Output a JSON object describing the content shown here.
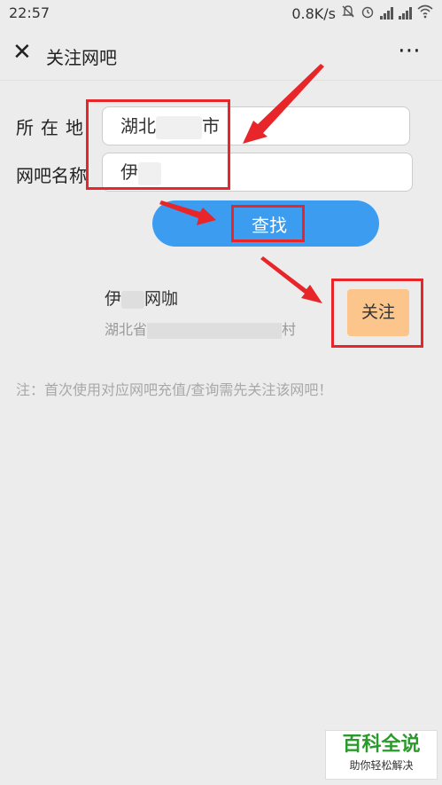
{
  "status_bar": {
    "time": "22:57",
    "network_speed": "0.8K/s",
    "icons": [
      "bell-muted-icon",
      "alarm-icon",
      "signal-icon",
      "signal-icon",
      "wifi-icon"
    ]
  },
  "nav": {
    "close_icon": "close-icon",
    "title": "关注网吧",
    "more_icon": "more-icon"
  },
  "form": {
    "location_label": "所在地",
    "location_value_start": "湖北",
    "location_value_end": "市",
    "cafe_name_label": "网吧名称",
    "cafe_name_value": "伊",
    "search_button": "查找"
  },
  "result": {
    "name_start": "伊",
    "name_end": "网咖",
    "address_start": "湖北省",
    "address_end": "村",
    "follow_button": "关注"
  },
  "note": "注：首次使用对应网吧充值/查询需先关注该网吧！",
  "watermark": {
    "title": "百科全说",
    "subtitle": "助你轻松解决"
  },
  "colors": {
    "background": "#ececec",
    "search_button": "#3b9cf0",
    "follow_button": "#fbc58b",
    "annotation_red": "#e8262a",
    "watermark_green": "#2a9a2a"
  }
}
